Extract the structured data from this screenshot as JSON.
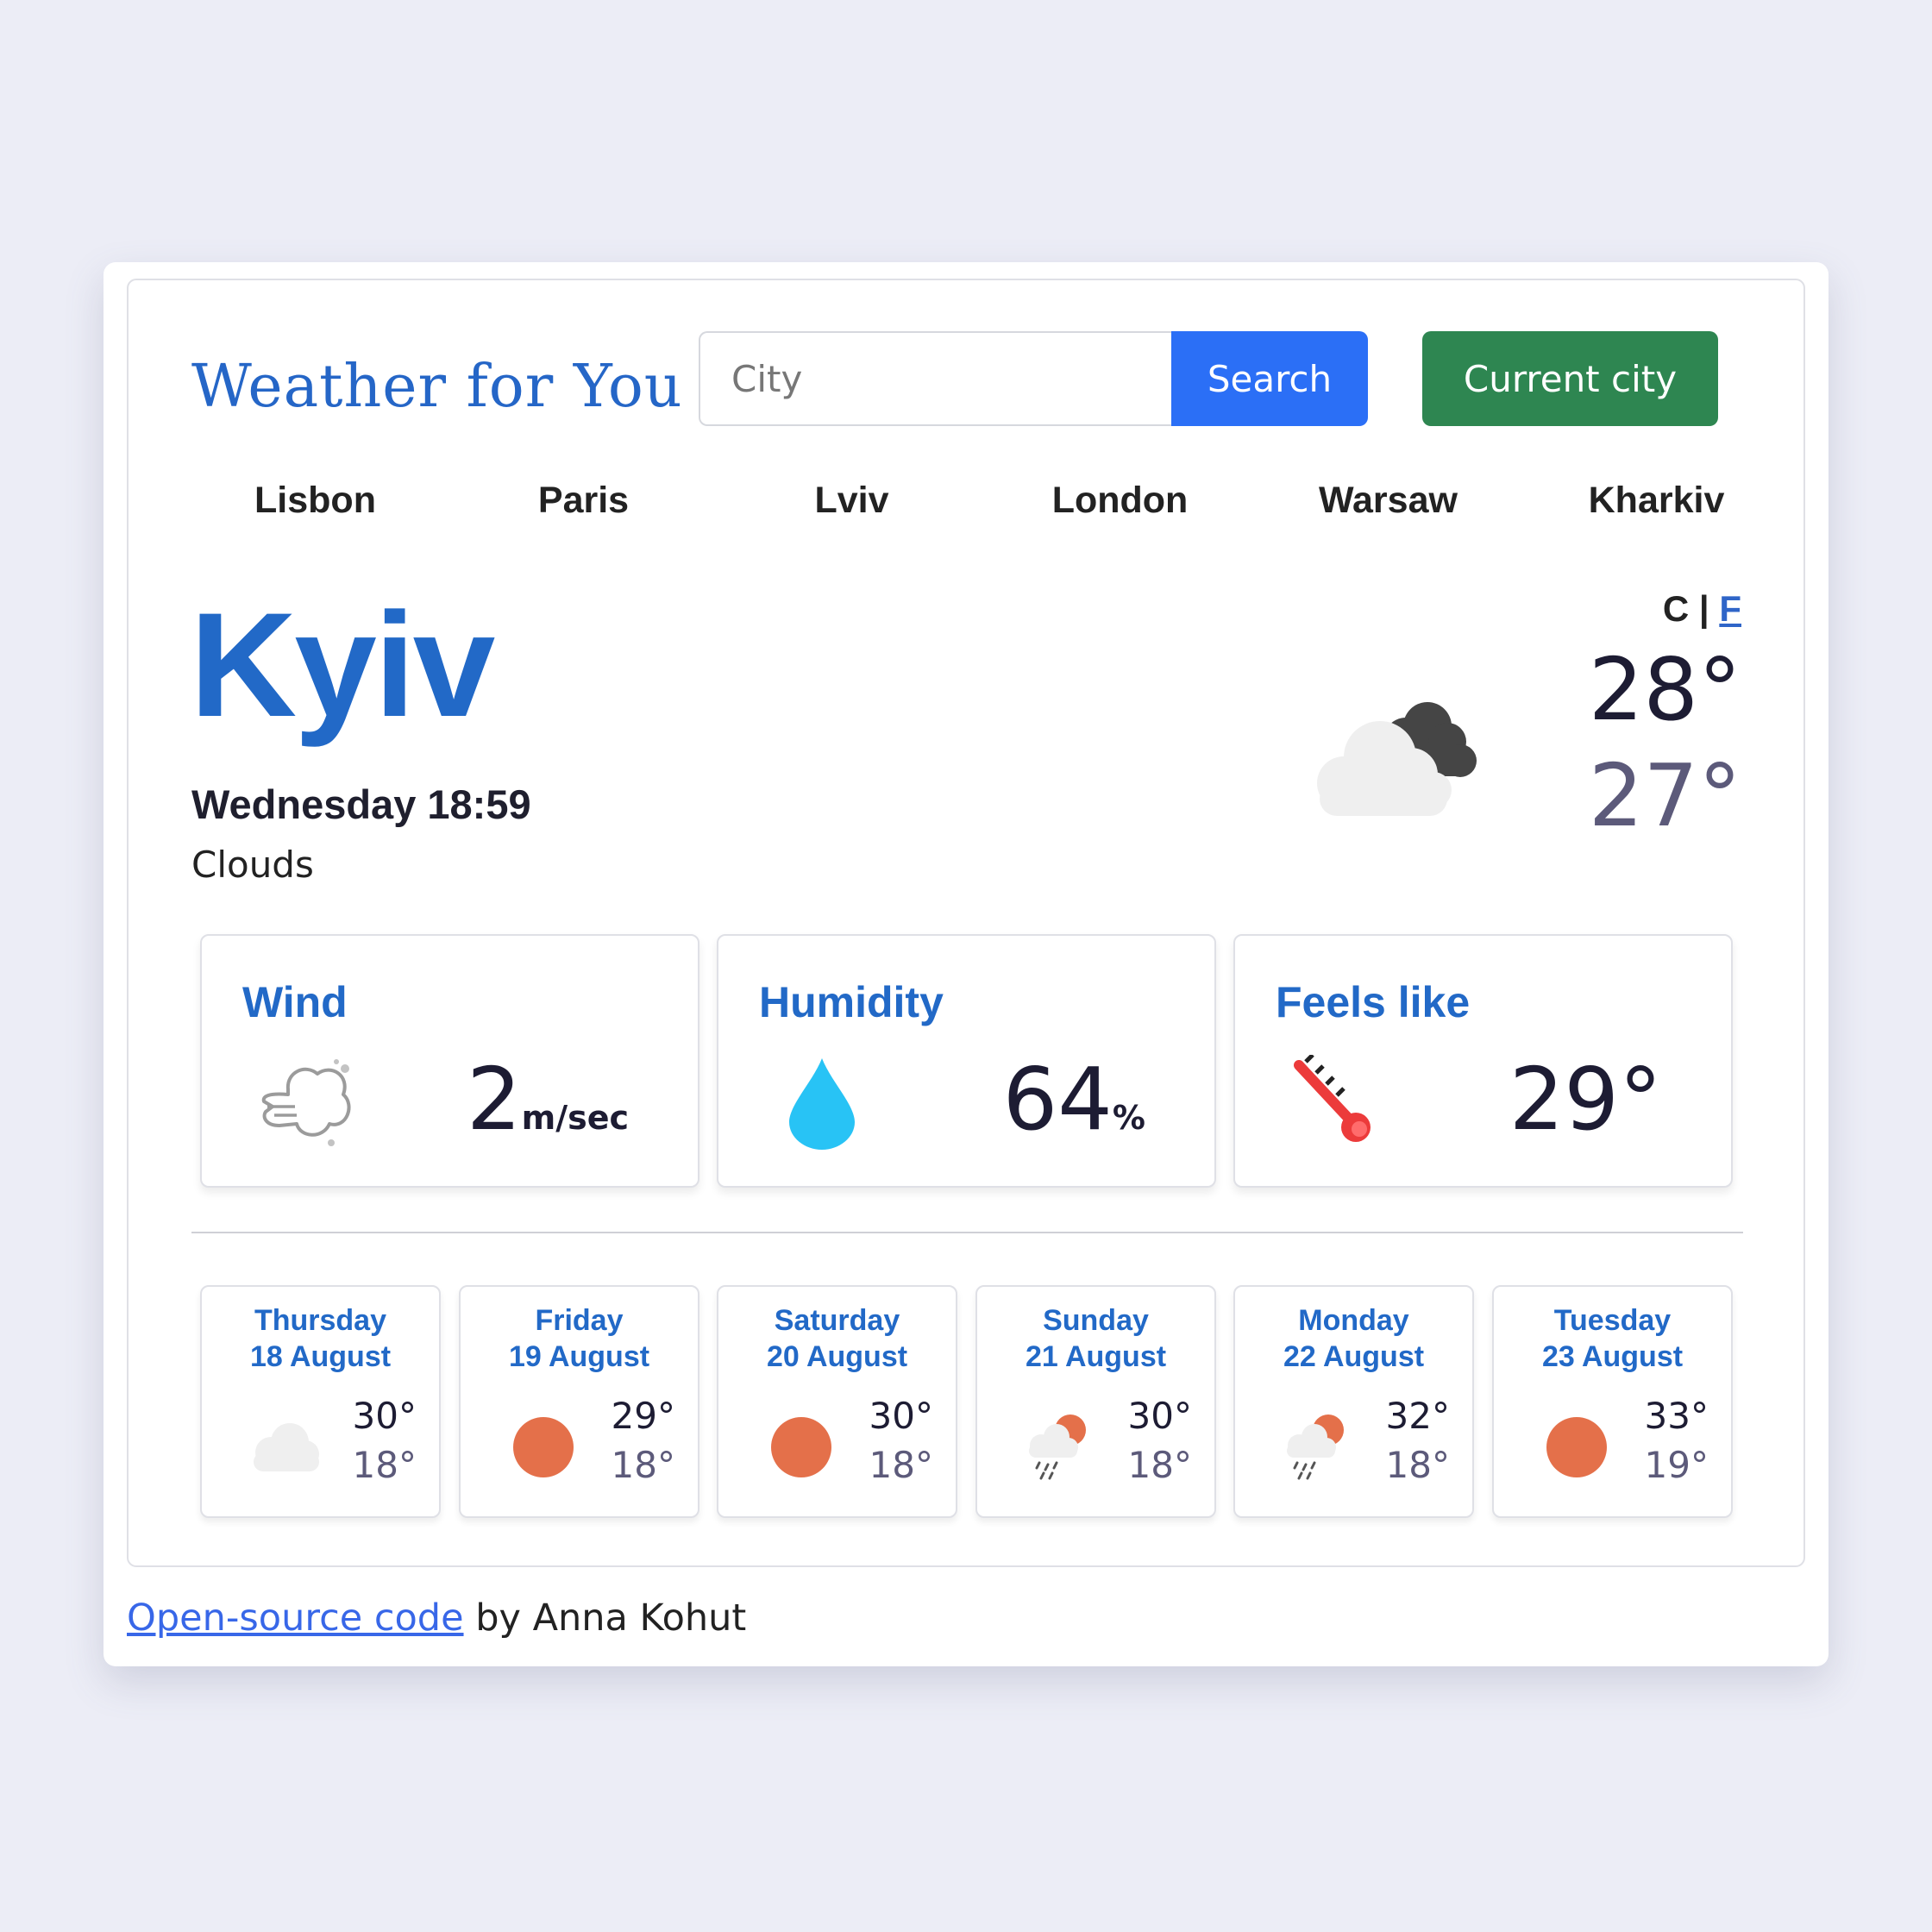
{
  "app": {
    "title": "Weather for You"
  },
  "search": {
    "placeholder": "City",
    "button_label": "Search",
    "current_city_label": "Current city"
  },
  "cities": [
    "Lisbon",
    "Paris",
    "Lviv",
    "London",
    "Warsaw",
    "Kharkiv"
  ],
  "current": {
    "city": "Kyiv",
    "datetime": "Wednesday 18:59",
    "description": "Clouds",
    "unit_c": "C",
    "unit_separator": "|",
    "unit_f": "F",
    "temp_max": "28°",
    "temp_min": "27°",
    "icon": "broken-clouds-icon"
  },
  "stats": {
    "wind": {
      "title": "Wind",
      "value": "2",
      "unit": "m/sec",
      "icon": "wind-icon"
    },
    "humidity": {
      "title": "Humidity",
      "value": "64",
      "unit": "%",
      "icon": "water-drop-icon"
    },
    "feels_like": {
      "title": "Feels like",
      "value": "29°",
      "icon": "thermometer-icon"
    }
  },
  "forecast": [
    {
      "day": "Thursday",
      "date": "18 August",
      "max": "30°",
      "min": "18°",
      "icon": "cloud-icon"
    },
    {
      "day": "Friday",
      "date": "19 August",
      "max": "29°",
      "min": "18°",
      "icon": "sun-icon"
    },
    {
      "day": "Saturday",
      "date": "20 August",
      "max": "30°",
      "min": "18°",
      "icon": "sun-icon"
    },
    {
      "day": "Sunday",
      "date": "21 August",
      "max": "30°",
      "min": "18°",
      "icon": "rain-sun-icon"
    },
    {
      "day": "Monday",
      "date": "22 August",
      "max": "32°",
      "min": "18°",
      "icon": "rain-sun-icon"
    },
    {
      "day": "Tuesday",
      "date": "23 August",
      "max": "33°",
      "min": "19°",
      "icon": "sun-icon"
    }
  ],
  "footer": {
    "link_text": "Open-source code",
    "author_text": " by Anna Kohut"
  },
  "colors": {
    "accent_blue": "#2269c7",
    "search_button": "#2b6ff6",
    "current_city_button": "#2e8651",
    "sun": "#e4704a",
    "drop": "#28c3f5"
  }
}
